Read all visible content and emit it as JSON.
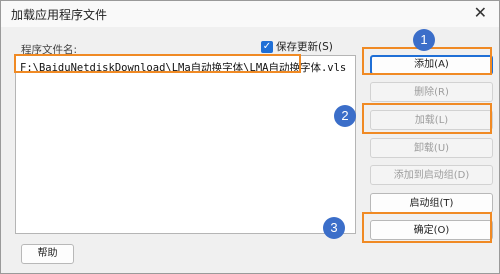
{
  "window": {
    "title": "加载应用程序文件",
    "close_glyph": "✕"
  },
  "files_label": "程序文件名:",
  "save_updates": {
    "label": "保存更新(S)",
    "checked": true,
    "check_glyph": "✓"
  },
  "file_list": [
    "F:\\BaiduNetdiskDownload\\LMa自动换字体\\LMA自动换字体.vls"
  ],
  "buttons": {
    "add": "添加(A)",
    "remove": "删除(R)",
    "load": "加载(L)",
    "unload": "卸载(U)",
    "add_to_startup": "添加到启动组(D)",
    "startup_group": "启动组(T)",
    "ok": "确定(O)",
    "help": "帮助"
  },
  "annotations": {
    "badges": [
      "1",
      "2",
      "3"
    ],
    "accent_color": "#f08a24",
    "badge_color": "#3b6ec9"
  }
}
